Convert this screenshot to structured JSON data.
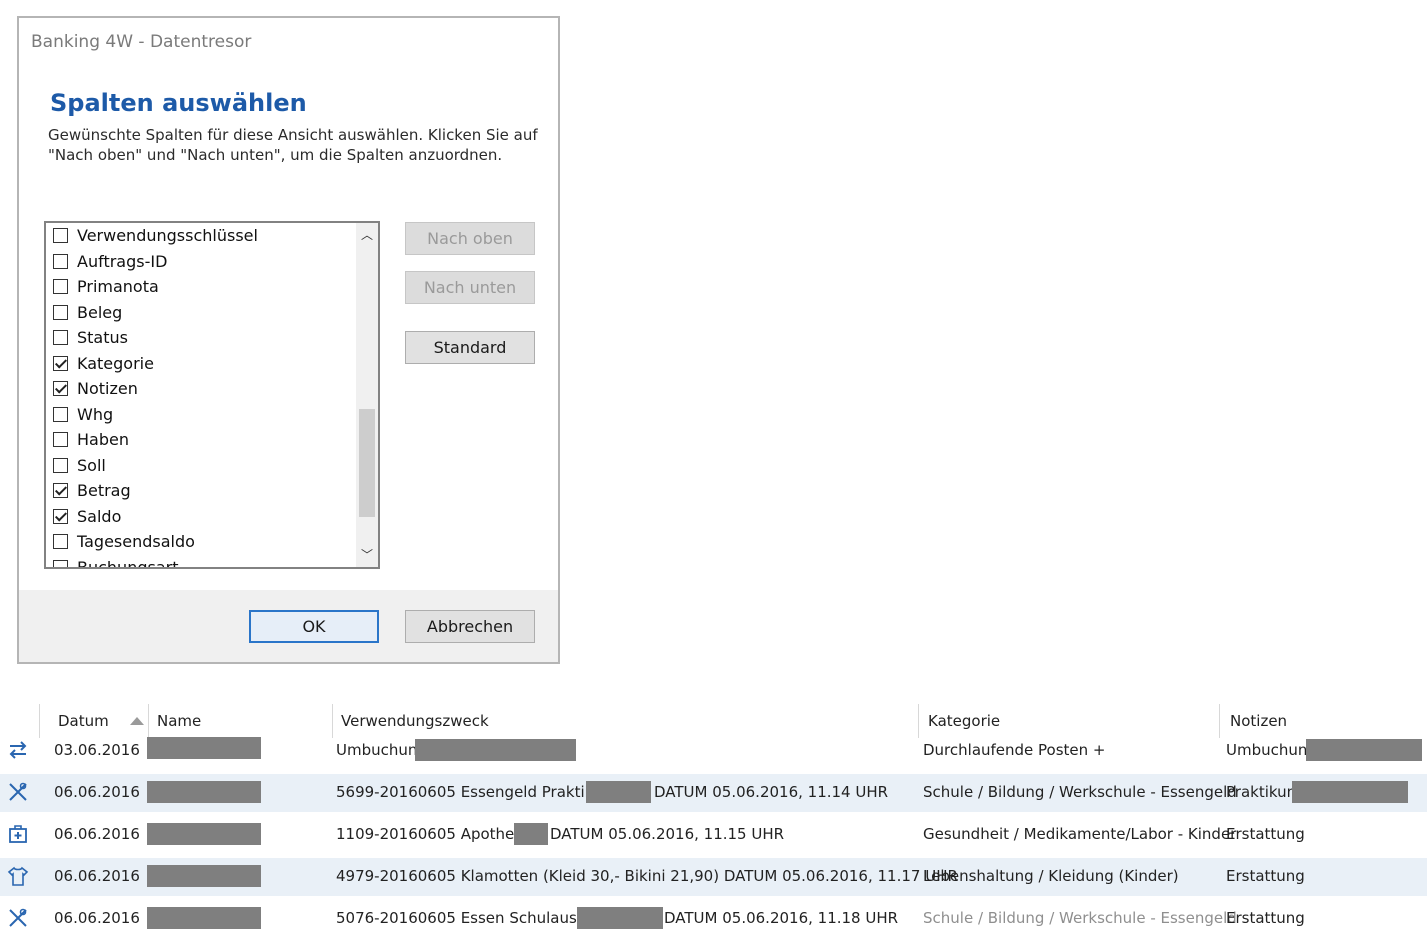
{
  "dialog": {
    "window_title": "Banking 4W - Datentresor",
    "heading": "Spalten auswählen",
    "description": "Gewünschte Spalten für diese Ansicht auswählen. Klicken Sie auf \"Nach oben\" und \"Nach unten\", um die Spalten anzuordnen.",
    "columns": [
      {
        "label": "Verwendungsschlüssel",
        "checked": false
      },
      {
        "label": "Auftrags-ID",
        "checked": false
      },
      {
        "label": "Primanota",
        "checked": false
      },
      {
        "label": "Beleg",
        "checked": false
      },
      {
        "label": "Status",
        "checked": false
      },
      {
        "label": "Kategorie",
        "checked": true
      },
      {
        "label": "Notizen",
        "checked": true
      },
      {
        "label": "Whg",
        "checked": false
      },
      {
        "label": "Haben",
        "checked": false
      },
      {
        "label": "Soll",
        "checked": false
      },
      {
        "label": "Betrag",
        "checked": true
      },
      {
        "label": "Saldo",
        "checked": true
      },
      {
        "label": "Tagesendsaldo",
        "checked": false
      },
      {
        "label": "Buchungsart",
        "checked": false
      }
    ],
    "buttons": {
      "up": "Nach oben",
      "down": "Nach unten",
      "standard": "Standard",
      "ok": "OK",
      "cancel": "Abbrechen"
    }
  },
  "table": {
    "headers": {
      "datum": "Datum",
      "name": "Name",
      "zweck": "Verwendungszweck",
      "kategorie": "Kategorie",
      "notizen": "Notizen"
    },
    "rows": [
      {
        "icon": "transfer-icon",
        "date": "03.06.2016",
        "zweck": "Umbuchung",
        "zweck_suffix": "",
        "kategorie": "Durchlaufende Posten +",
        "notiz": "Umbuchung",
        "muted_kategorie": false
      },
      {
        "icon": "cutlery-icon",
        "date": "06.06.2016",
        "zweck": "5699-20160605 Essengeld Praktikum",
        "zweck_suffix": "DATUM 05.06.2016, 11.14 UHR",
        "kategorie": "Schule / Bildung / Werkschule - Essengeld",
        "notiz": "Praktikum",
        "muted_kategorie": false
      },
      {
        "icon": "medical-kit-icon",
        "date": "06.06.2016",
        "zweck": "1109-20160605 Apotheke",
        "zweck_suffix": "DATUM 05.06.2016, 11.15 UHR",
        "kategorie": "Gesundheit / Medikamente/Labor - Kinder",
        "notiz": "Erstattung",
        "muted_kategorie": false
      },
      {
        "icon": "shirt-icon",
        "date": "06.06.2016",
        "zweck": "4979-20160605 Klamotten (Kleid 30,- Bikini 21,90) DATUM 05.06.2016, 11.17 UHR",
        "zweck_suffix": "",
        "kategorie": "Lebenshaltung / Kleidung (Kinder)",
        "notiz": "Erstattung",
        "muted_kategorie": false
      },
      {
        "icon": "cutlery-icon",
        "date": "06.06.2016",
        "zweck": "5076-20160605 Essen Schulausflug",
        "zweck_suffix": "DATUM 05.06.2016, 11.18 UHR",
        "kategorie": "Schule / Bildung / Werkschule - Essengeld",
        "notiz": "Erstattung",
        "muted_kategorie": true
      }
    ]
  }
}
